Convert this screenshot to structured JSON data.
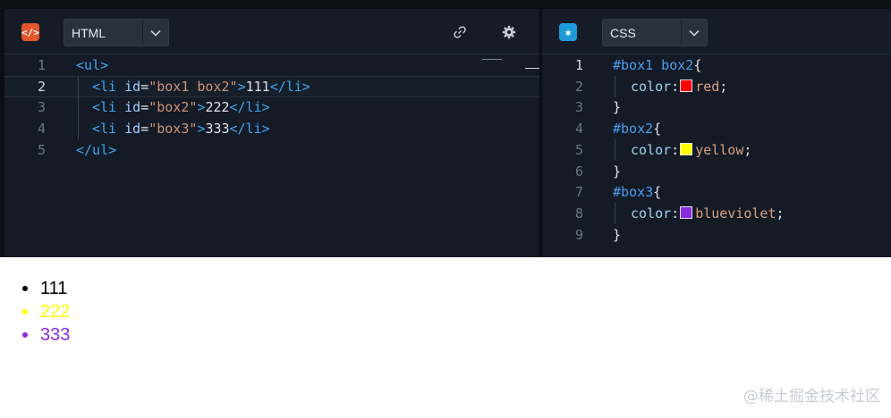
{
  "html_pane": {
    "language_icon": "html-code-icon",
    "language_select": "HTML",
    "header_actions": [
      "link-icon",
      "gear-icon"
    ],
    "lines": [
      {
        "num": "1",
        "tokens": [
          {
            "t": "<ul>",
            "c": "tag"
          }
        ]
      },
      {
        "num": "2",
        "tokens": [
          {
            "t": "<li ",
            "c": "tag"
          },
          {
            "t": "id",
            "c": "attr"
          },
          {
            "t": "=",
            "c": "plain"
          },
          {
            "t": "\"box1 box2\"",
            "c": "str"
          },
          {
            "t": ">",
            "c": "tag"
          },
          {
            "t": "111",
            "c": "plain"
          },
          {
            "t": "</li>",
            "c": "tag"
          }
        ]
      },
      {
        "num": "3",
        "tokens": [
          {
            "t": "<li ",
            "c": "tag"
          },
          {
            "t": "id",
            "c": "attr"
          },
          {
            "t": "=",
            "c": "plain"
          },
          {
            "t": "\"box2\"",
            "c": "str"
          },
          {
            "t": ">",
            "c": "tag"
          },
          {
            "t": "222",
            "c": "plain"
          },
          {
            "t": "</li>",
            "c": "tag"
          }
        ]
      },
      {
        "num": "4",
        "tokens": [
          {
            "t": "<li ",
            "c": "tag"
          },
          {
            "t": "id",
            "c": "attr"
          },
          {
            "t": "=",
            "c": "plain"
          },
          {
            "t": "\"box3\"",
            "c": "str"
          },
          {
            "t": ">",
            "c": "tag"
          },
          {
            "t": "333",
            "c": "plain"
          },
          {
            "t": "</li>",
            "c": "tag"
          }
        ]
      },
      {
        "num": "5",
        "tokens": [
          {
            "t": "</ul>",
            "c": "tag"
          }
        ]
      }
    ]
  },
  "css_pane": {
    "language_icon": "css-asterisk-icon",
    "language_select": "CSS",
    "lines": [
      {
        "num": "1",
        "tokens": [
          {
            "t": "#box1 box2",
            "c": "sel"
          },
          {
            "t": "{",
            "c": "plain"
          }
        ]
      },
      {
        "num": "2",
        "tokens": [
          {
            "t": "color",
            "c": "prop"
          },
          {
            "t": ":",
            "c": "plain"
          },
          {
            "swatch": "#ff0000"
          },
          {
            "t": "red",
            "c": "val"
          },
          {
            "t": ";",
            "c": "plain"
          }
        ]
      },
      {
        "num": "3",
        "tokens": [
          {
            "t": "}",
            "c": "plain"
          }
        ]
      },
      {
        "num": "4",
        "tokens": [
          {
            "t": "#box2",
            "c": "sel"
          },
          {
            "t": "{",
            "c": "plain"
          }
        ]
      },
      {
        "num": "5",
        "tokens": [
          {
            "t": "color",
            "c": "prop"
          },
          {
            "t": ":",
            "c": "plain"
          },
          {
            "swatch": "#ffff00"
          },
          {
            "t": "yellow",
            "c": "val"
          },
          {
            "t": ";",
            "c": "plain"
          }
        ]
      },
      {
        "num": "6",
        "tokens": [
          {
            "t": "}",
            "c": "plain"
          }
        ]
      },
      {
        "num": "7",
        "tokens": [
          {
            "t": "#box3",
            "c": "sel"
          },
          {
            "t": "{",
            "c": "plain"
          }
        ]
      },
      {
        "num": "8",
        "tokens": [
          {
            "t": "color",
            "c": "prop"
          },
          {
            "t": ":",
            "c": "plain"
          },
          {
            "swatch": "#8a2be2"
          },
          {
            "t": "blueviolet",
            "c": "val"
          },
          {
            "t": ";",
            "c": "plain"
          }
        ]
      },
      {
        "num": "9",
        "tokens": [
          {
            "t": "}",
            "c": "plain"
          }
        ]
      }
    ]
  },
  "output": {
    "items": [
      {
        "text": "111",
        "color": "#000000"
      },
      {
        "text": "222",
        "color": "#ffff00"
      },
      {
        "text": "333",
        "color": "#8a2be2"
      }
    ]
  },
  "watermark": "@稀土掘金技术社区"
}
